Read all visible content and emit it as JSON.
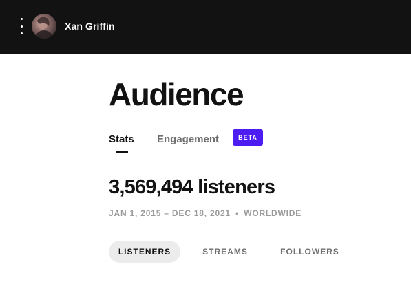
{
  "header": {
    "menu_icon": "kebab-menu-icon",
    "avatar_icon": "artist-avatar",
    "artist_name": "Xan Griffin"
  },
  "page": {
    "title": "Audience",
    "tabs": [
      {
        "label": "Stats",
        "active": true
      },
      {
        "label": "Engagement",
        "active": false
      }
    ],
    "beta_badge": "BETA"
  },
  "summary": {
    "metric": "3,569,494 listeners",
    "date_range": "JAN 1, 2015 – DEC 18, 2021",
    "separator": "•",
    "region": "WORLDWIDE"
  },
  "metric_tabs": [
    {
      "label": "LISTENERS",
      "active": true
    },
    {
      "label": "STREAMS",
      "active": false
    },
    {
      "label": "FOLLOWERS",
      "active": false
    }
  ],
  "colors": {
    "topbar": "#121212",
    "beta": "#4c1cf2",
    "active_pill": "#ececec",
    "muted_text": "#9a9a9a"
  }
}
